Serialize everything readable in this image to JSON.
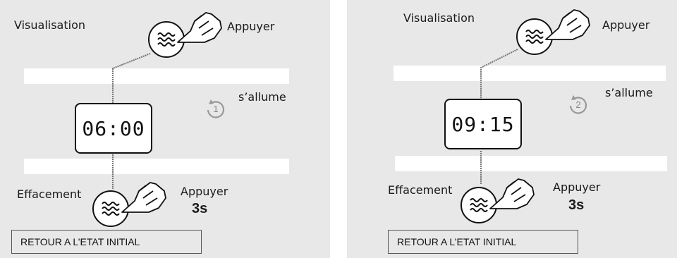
{
  "panels": [
    {
      "id": "left",
      "label_visualisation": "Visualisation",
      "label_press_top": "Appuyer",
      "label_lights": "s’allume",
      "badge_number": "1",
      "display_time": "06:00",
      "label_erase": "Effacement",
      "label_press_bottom": "Appuyer",
      "label_duration": "3s",
      "reset_text": "RETOUR A L’ETAT INITIAL"
    },
    {
      "id": "right",
      "label_visualisation": "Visualisation",
      "label_press_top": "Appuyer",
      "label_lights": "s’allume",
      "badge_number": "2",
      "display_time": "09:15",
      "label_erase": "Effacement",
      "label_press_bottom": "Appuyer",
      "label_duration": "3s",
      "reset_text": "RETOUR A L’ETAT INITIAL"
    }
  ],
  "icons": {
    "button": "heat-waves-icon",
    "hand": "pointing-hand-icon",
    "badge": "rotation-badge-icon"
  },
  "colors": {
    "panel_bg": "#e8e8e8",
    "band": "#ffffff",
    "line": "#777777",
    "badge": "#999999"
  }
}
